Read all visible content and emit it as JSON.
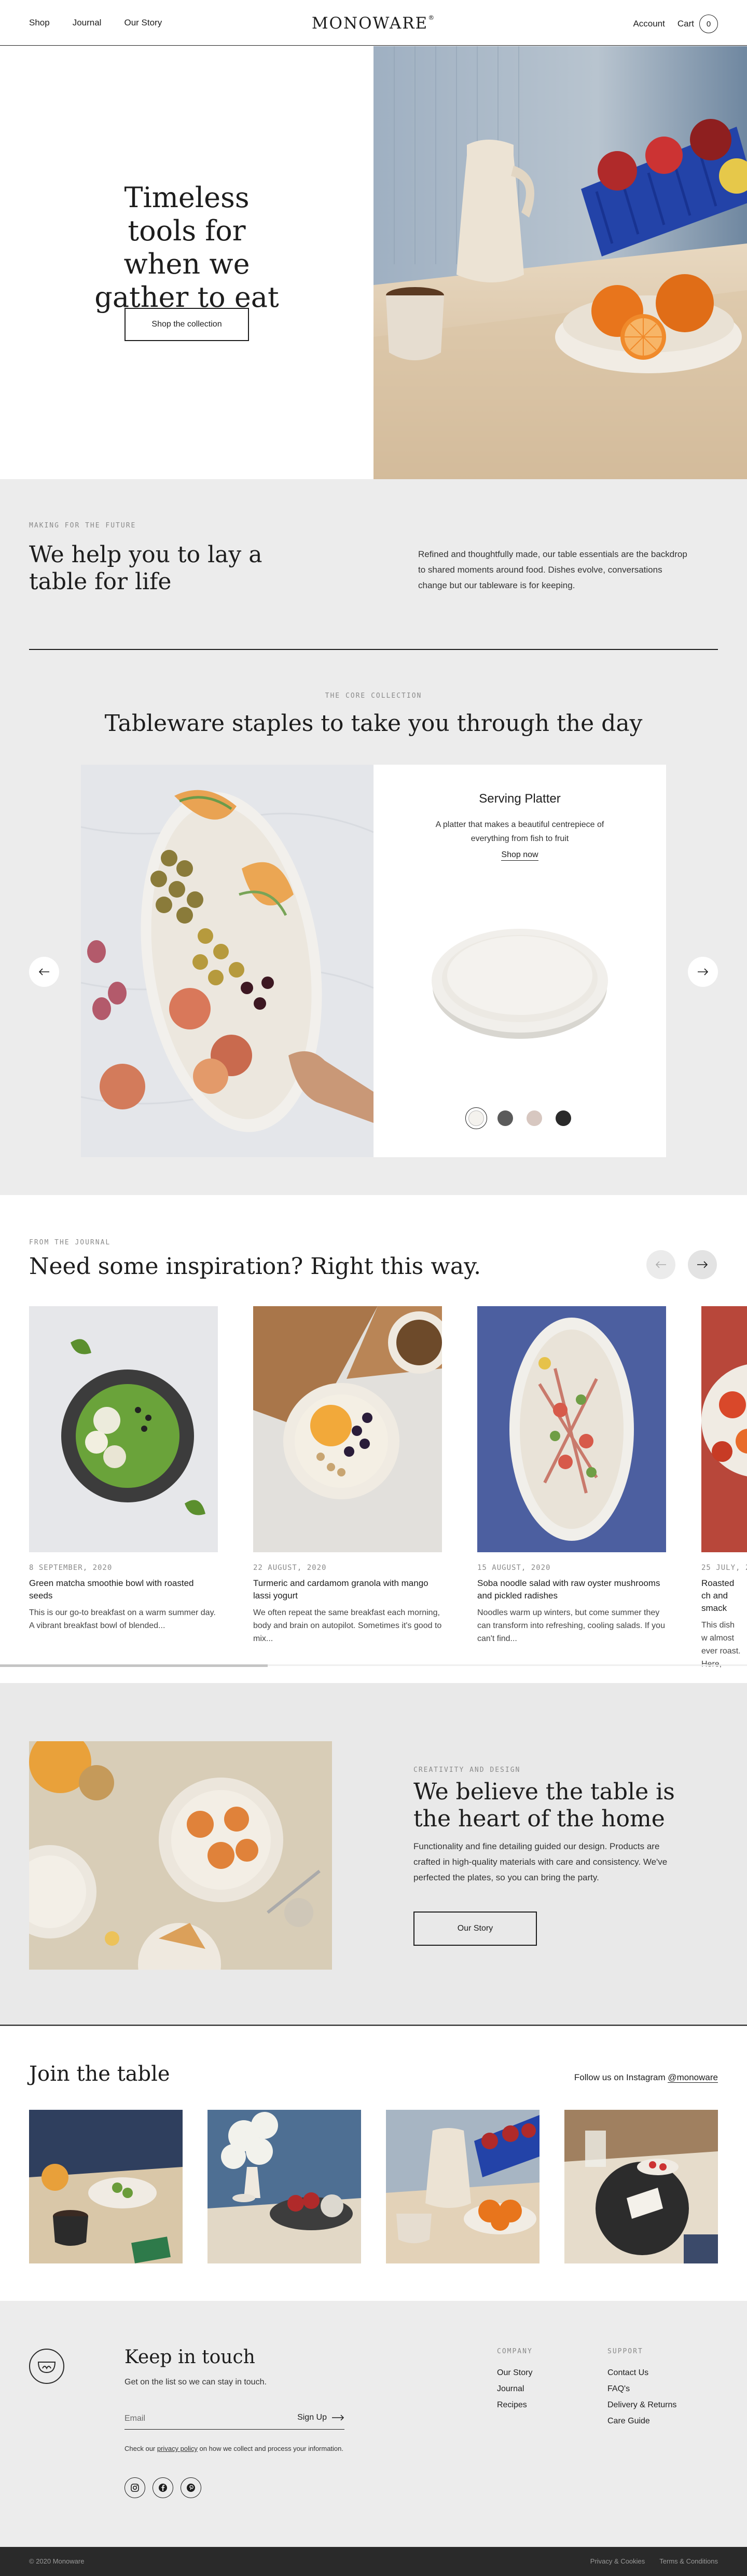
{
  "header": {
    "nav_left": [
      "Shop",
      "Journal",
      "Our Story"
    ],
    "logo": "MONOWARE",
    "logo_mark": "®",
    "account": "Account",
    "cart": "Cart",
    "cart_count": "0"
  },
  "hero": {
    "title": "Timeless tools for when we gather to eat",
    "button": "Shop the collection"
  },
  "intro": {
    "eyebrow": "MAKING FOR THE FUTURE",
    "title": "We help you to lay a table for life",
    "body": "Refined and thoughtfully made, our table essentials are the backdrop to shared moments around food. Dishes evolve, conversations change but our tableware is for keeping."
  },
  "collection": {
    "eyebrow": "THE CORE COLLECTION",
    "title": "Tableware staples to take you through the day",
    "product": {
      "name": "Serving Platter",
      "description": "A platter that makes a beautiful centrepiece of everything from fish to fruit",
      "link": "Shop now"
    },
    "swatches": [
      "#f4f2ee",
      "#5b5b5b",
      "#d7c7c0",
      "#2a2a2a"
    ]
  },
  "journal": {
    "eyebrow": "FROM THE JOURNAL",
    "title": "Need some inspiration? Right this way.",
    "articles": [
      {
        "date": "8 SEPTEMBER, 2020",
        "title": "Green matcha smoothie bowl with roasted seeds",
        "excerpt": "This is our go-to breakfast on a warm summer day. A vibrant breakfast bowl of blended..."
      },
      {
        "date": "22 AUGUST, 2020",
        "title": "Turmeric and cardamom granola with mango lassi yogurt",
        "excerpt": "We often repeat the same breakfast each morning, body and brain on autopilot. Sometimes it's good to mix..."
      },
      {
        "date": "15 AUGUST, 2020",
        "title": "Soba noodle salad with raw oyster mushrooms and pickled radishes",
        "excerpt": "Noodles warm up winters, but come summer they can transform into refreshing, cooling salads. If you can't find..."
      },
      {
        "date": "25 JULY, 2",
        "title": "Roasted ch and smack",
        "excerpt": "This dish w almost ever roast. Here,"
      }
    ]
  },
  "believe": {
    "eyebrow": "CREATIVITY AND DESIGN",
    "title": "We believe the table is the heart of the home",
    "body": "Functionality and fine detailing guided our design. Products are crafted in high-quality materials with care and consistency. We've perfected the plates, so you can bring the party.",
    "button": "Our Story"
  },
  "join": {
    "title": "Join the table",
    "follow": "Follow us on Instagram",
    "handle": "@monoware"
  },
  "footer": {
    "title": "Keep in touch",
    "subtitle": "Get on the list so we can stay in touch.",
    "email_placeholder": "Email",
    "signup": "Sign Up",
    "privacy_pre": "Check our",
    "privacy_link": "privacy policy",
    "privacy_post": "on how we collect and process your information.",
    "company_title": "COMPANY",
    "company_links": [
      "Our Story",
      "Journal",
      "Recipes"
    ],
    "support_title": "SUPPORT",
    "support_links": [
      "Contact Us",
      "FAQ's",
      "Delivery & Returns",
      "Care Guide"
    ],
    "copyright": "© 2020 Monoware",
    "legal": [
      "Privacy & Cookies",
      "Terms & Conditions"
    ]
  }
}
